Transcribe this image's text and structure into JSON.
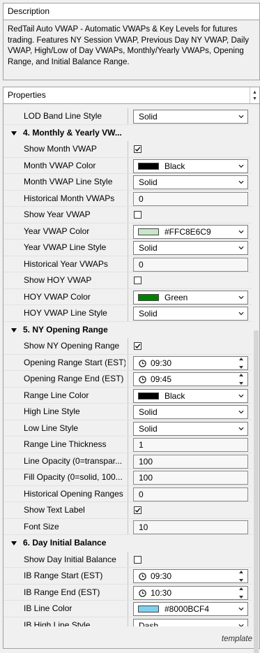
{
  "description": {
    "header": "Description",
    "text": "RedTail Auto VWAP - Automatic VWAPs & Key Levels for futures trading. Features NY Session VWAP, Previous Day NY VWAP, Daily VWAP, High/Low of Day VWAPs, Monthly/Yearly VWAPs, Opening Range, and Initial Balance Range."
  },
  "properties": {
    "header": "Properties",
    "footer": "template",
    "rows": [
      {
        "kind": "select",
        "label": "LOD Band Line Style",
        "value": "Solid"
      },
      {
        "kind": "category",
        "label": "4. Monthly & Yearly VW..."
      },
      {
        "kind": "check",
        "label": "Show Month VWAP",
        "checked": true
      },
      {
        "kind": "color",
        "label": "Month VWAP Color",
        "value": "Black",
        "swatch": "#000000"
      },
      {
        "kind": "select",
        "label": "Month VWAP Line Style",
        "value": "Solid"
      },
      {
        "kind": "text",
        "label": "Historical Month VWAPs",
        "value": "0"
      },
      {
        "kind": "check",
        "label": "Show Year VWAP",
        "checked": false
      },
      {
        "kind": "color",
        "label": "Year VWAP Color",
        "value": "#FFC8E6C9",
        "swatch": "#C8E6C9"
      },
      {
        "kind": "select",
        "label": "Year VWAP Line Style",
        "value": "Solid"
      },
      {
        "kind": "text",
        "label": "Historical Year VWAPs",
        "value": "0"
      },
      {
        "kind": "check",
        "label": "Show HOY VWAP",
        "checked": false
      },
      {
        "kind": "color",
        "label": "HOY VWAP Color",
        "value": "Green",
        "swatch": "#008000"
      },
      {
        "kind": "select",
        "label": "HOY VWAP Line Style",
        "value": "Solid"
      },
      {
        "kind": "category",
        "label": "5. NY Opening Range"
      },
      {
        "kind": "check",
        "label": "Show NY Opening Range",
        "checked": true
      },
      {
        "kind": "time",
        "label": "Opening Range Start (EST)",
        "value": "09:30"
      },
      {
        "kind": "time",
        "label": "Opening Range End (EST)",
        "value": "09:45"
      },
      {
        "kind": "color",
        "label": "Range Line Color",
        "value": "Black",
        "swatch": "#000000"
      },
      {
        "kind": "select",
        "label": "High Line Style",
        "value": "Solid"
      },
      {
        "kind": "select",
        "label": "Low Line Style",
        "value": "Solid"
      },
      {
        "kind": "text",
        "label": "Range Line Thickness",
        "value": "1"
      },
      {
        "kind": "text",
        "label": "Line Opacity (0=transpar...",
        "value": "100"
      },
      {
        "kind": "text",
        "label": "Fill Opacity (0=solid, 100...",
        "value": "100"
      },
      {
        "kind": "text",
        "label": "Historical Opening Ranges",
        "value": "0"
      },
      {
        "kind": "check",
        "label": "Show Text Label",
        "checked": true
      },
      {
        "kind": "text",
        "label": "Font Size",
        "value": "10"
      },
      {
        "kind": "category",
        "label": "6. Day Initial Balance"
      },
      {
        "kind": "check",
        "label": "Show Day Initial Balance",
        "checked": false
      },
      {
        "kind": "time",
        "label": "IB Range Start (EST)",
        "value": "09:30"
      },
      {
        "kind": "time",
        "label": "IB Range End (EST)",
        "value": "10:30"
      },
      {
        "kind": "color",
        "label": "IB Line Color",
        "value": "#8000BCF4",
        "swatch": "#7FD0EE"
      },
      {
        "kind": "select",
        "label": "IB High Line Style",
        "value": "Dash"
      }
    ]
  }
}
